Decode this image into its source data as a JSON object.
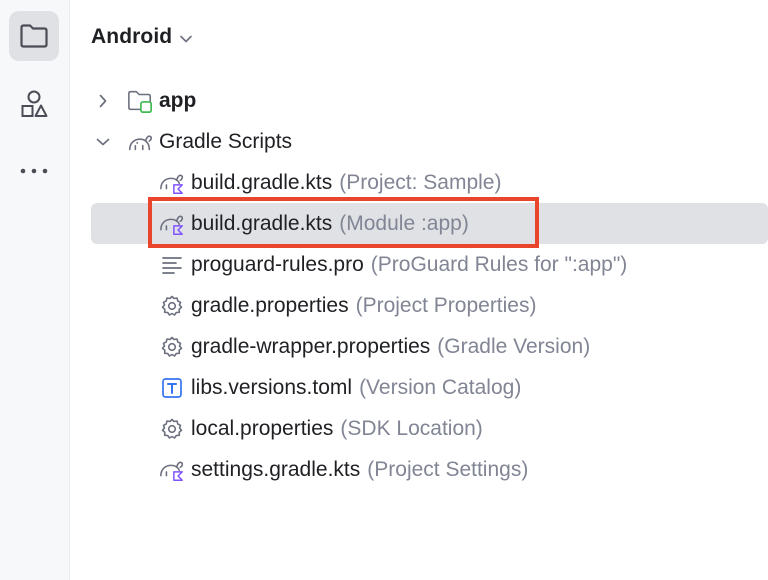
{
  "panel": {
    "title": "Android"
  },
  "sidebar": {
    "items": [
      {
        "icon": "folder-icon",
        "active": true
      },
      {
        "icon": "structure-icon",
        "active": false
      },
      {
        "icon": "more-icon",
        "active": false
      }
    ]
  },
  "tree": {
    "app": {
      "name": "app"
    },
    "gradle_scripts": {
      "name": "Gradle Scripts"
    },
    "files": [
      {
        "name": "build.gradle.kts",
        "hint": "(Project: Sample)",
        "icon": "gradle-kotlin-icon"
      },
      {
        "name": "build.gradle.kts",
        "hint": "(Module :app)",
        "icon": "gradle-kotlin-icon",
        "selected": true
      },
      {
        "name": "proguard-rules.pro",
        "hint": "(ProGuard Rules for \":app\")",
        "icon": "text-file-icon"
      },
      {
        "name": "gradle.properties",
        "hint": "(Project Properties)",
        "icon": "gear-icon"
      },
      {
        "name": "gradle-wrapper.properties",
        "hint": "(Gradle Version)",
        "icon": "gear-icon"
      },
      {
        "name": "libs.versions.toml",
        "hint": "(Version Catalog)",
        "icon": "toml-icon"
      },
      {
        "name": "local.properties",
        "hint": "(SDK Location)",
        "icon": "gear-icon"
      },
      {
        "name": "settings.gradle.kts",
        "hint": "(Project Settings)",
        "icon": "gradle-kotlin-icon"
      }
    ]
  },
  "colors": {
    "highlight": "#e8452c",
    "selection": "#dfe1e5",
    "hint_text": "#818594",
    "kotlin_accent": "#7f52ff",
    "module_accent": "#3fb950"
  }
}
